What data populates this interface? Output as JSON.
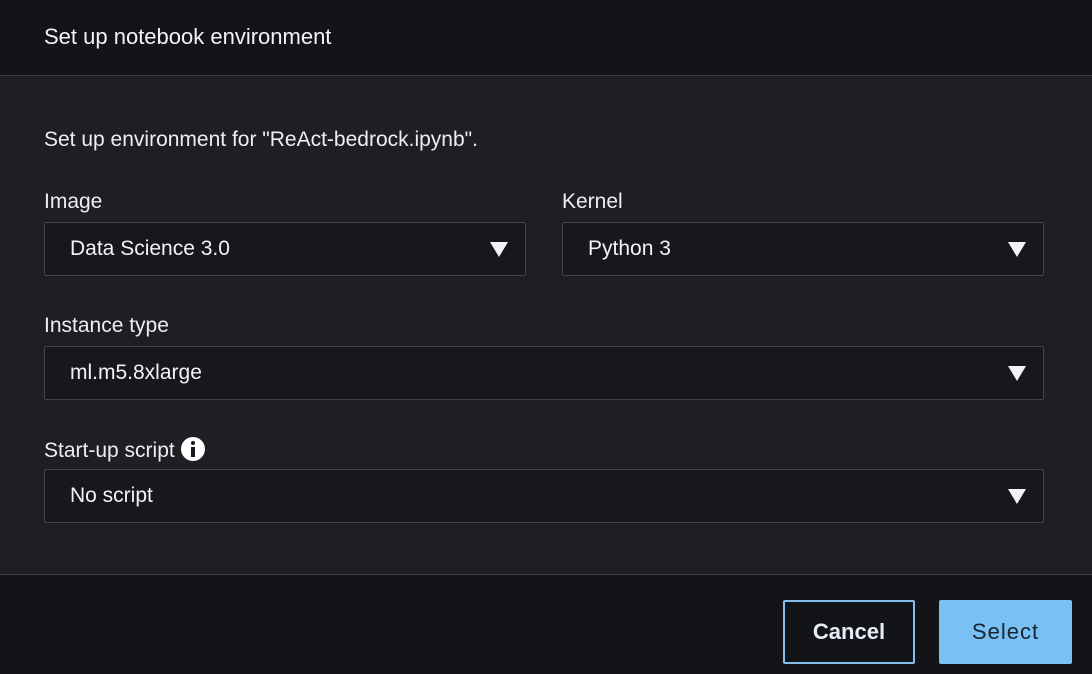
{
  "dialog": {
    "title": "Set up notebook environment",
    "description": "Set up environment for \"ReAct-bedrock.ipynb\"."
  },
  "fields": {
    "image": {
      "label": "Image",
      "value": "Data Science 3.0"
    },
    "kernel": {
      "label": "Kernel",
      "value": "Python 3"
    },
    "instance_type": {
      "label": "Instance type",
      "value": "ml.m5.8xlarge"
    },
    "startup_script": {
      "label": "Start-up script",
      "value": "No script",
      "icon": "info-icon"
    }
  },
  "actions": {
    "cancel_label": "Cancel",
    "select_label": "Select"
  },
  "colors": {
    "primary_button": "#79c0f5",
    "secondary_border": "#86bfee",
    "background": "#1d1f24"
  }
}
